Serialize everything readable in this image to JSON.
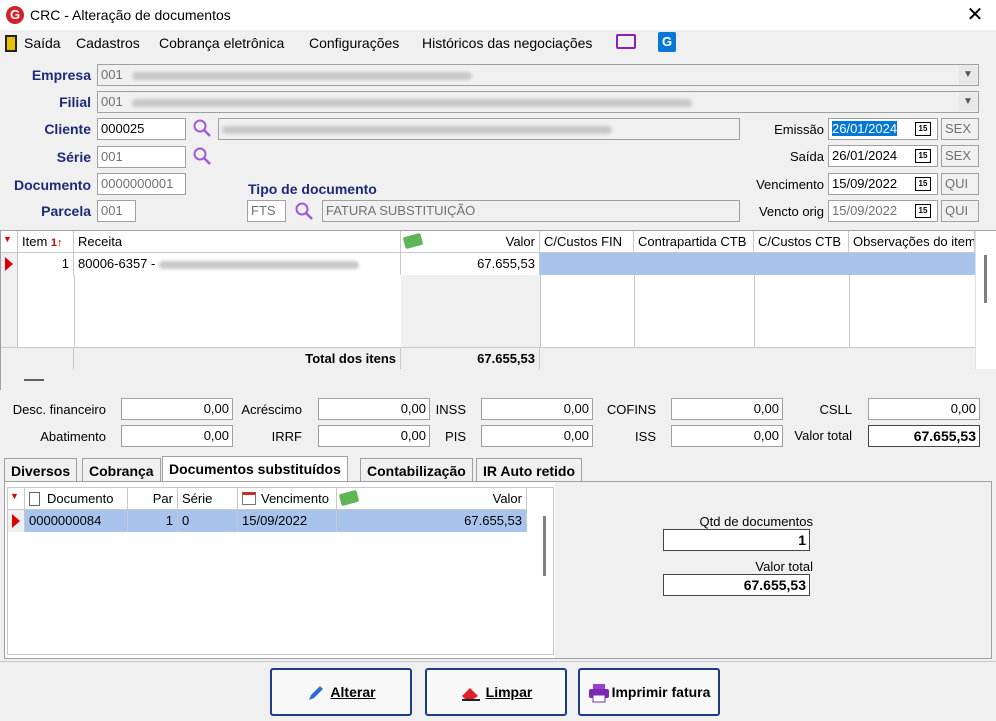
{
  "window": {
    "title": "CRC - Alteração de documentos",
    "close": "✕"
  },
  "menu": {
    "items": [
      "Saída",
      "Cadastros",
      "Cobrança eletrônica",
      "Configurações",
      "Históricos das negociações"
    ]
  },
  "form": {
    "empresa": {
      "label": "Empresa",
      "code": "001"
    },
    "filial": {
      "label": "Filial",
      "code": "001"
    },
    "cliente": {
      "label": "Cliente",
      "value": "000025"
    },
    "serie": {
      "label": "Série",
      "value": "001"
    },
    "documento": {
      "label": "Documento",
      "value": "0000000001"
    },
    "parcela": {
      "label": "Parcela",
      "value": "001"
    },
    "tipo_documento": {
      "label": "Tipo de documento",
      "code": "FTS",
      "description": "FATURA SUBSTITUIÇÃO"
    },
    "emissao": {
      "label": "Emissão",
      "date": "26/01/2024",
      "weekday": "SEX"
    },
    "saida": {
      "label": "Saída",
      "date": "26/01/2024",
      "weekday": "SEX"
    },
    "vencimento": {
      "label": "Vencimento",
      "date": "15/09/2022",
      "weekday": "QUI"
    },
    "vencto_orig": {
      "label": "Vencto orig",
      "date": "15/09/2022",
      "weekday": "QUI"
    }
  },
  "items_grid": {
    "columns": [
      "Item",
      "Receita",
      "Valor",
      "C/Custos FIN",
      "Contrapartida CTB",
      "C/Custos CTB",
      "Observações do item"
    ],
    "rows": [
      {
        "item": "1",
        "receita": "80006-6357 -",
        "valor": "67.655,53"
      }
    ],
    "total_label": "Total dos itens",
    "total_value": "67.655,53"
  },
  "totals": {
    "desc_financeiro": {
      "label": "Desc. financeiro",
      "value": "0,00"
    },
    "acrescimo": {
      "label": "Acréscimo",
      "value": "0,00"
    },
    "inss": {
      "label": "INSS",
      "value": "0,00"
    },
    "cofins": {
      "label": "COFINS",
      "value": "0,00"
    },
    "csll": {
      "label": "CSLL",
      "value": "0,00"
    },
    "abatimento": {
      "label": "Abatimento",
      "value": "0,00"
    },
    "irrf": {
      "label": "IRRF",
      "value": "0,00"
    },
    "pis": {
      "label": "PIS",
      "value": "0,00"
    },
    "iss": {
      "label": "ISS",
      "value": "0,00"
    },
    "valor_total": {
      "label": "Valor total",
      "value": "67.655,53"
    }
  },
  "tabs": [
    "Diversos",
    "Cobrança",
    "Documentos substituídos",
    "Contabilização",
    "IR Auto retido"
  ],
  "active_tab": "Documentos substituídos",
  "subst_grid": {
    "columns": [
      "Documento",
      "Par",
      "Série",
      "Vencimento",
      "Valor"
    ],
    "rows": [
      {
        "documento": "0000000084",
        "par": "1",
        "serie": "0",
        "vencimento": "15/09/2022",
        "valor": "67.655,53"
      }
    ]
  },
  "summary": {
    "qtd_label": "Qtd de documentos",
    "qtd_value": "1",
    "valor_label": "Valor total",
    "valor_value": "67.655,53"
  },
  "buttons": {
    "alterar": "Alterar",
    "limpar": "Limpar",
    "imprimir": "Imprimir fatura"
  },
  "colors": {
    "label_blue": "#1d2a7a",
    "selection": "#0078d7",
    "row_highlight": "#a8c4ec",
    "brand_red": "#d2232a",
    "button_border": "#1f3b8a"
  }
}
